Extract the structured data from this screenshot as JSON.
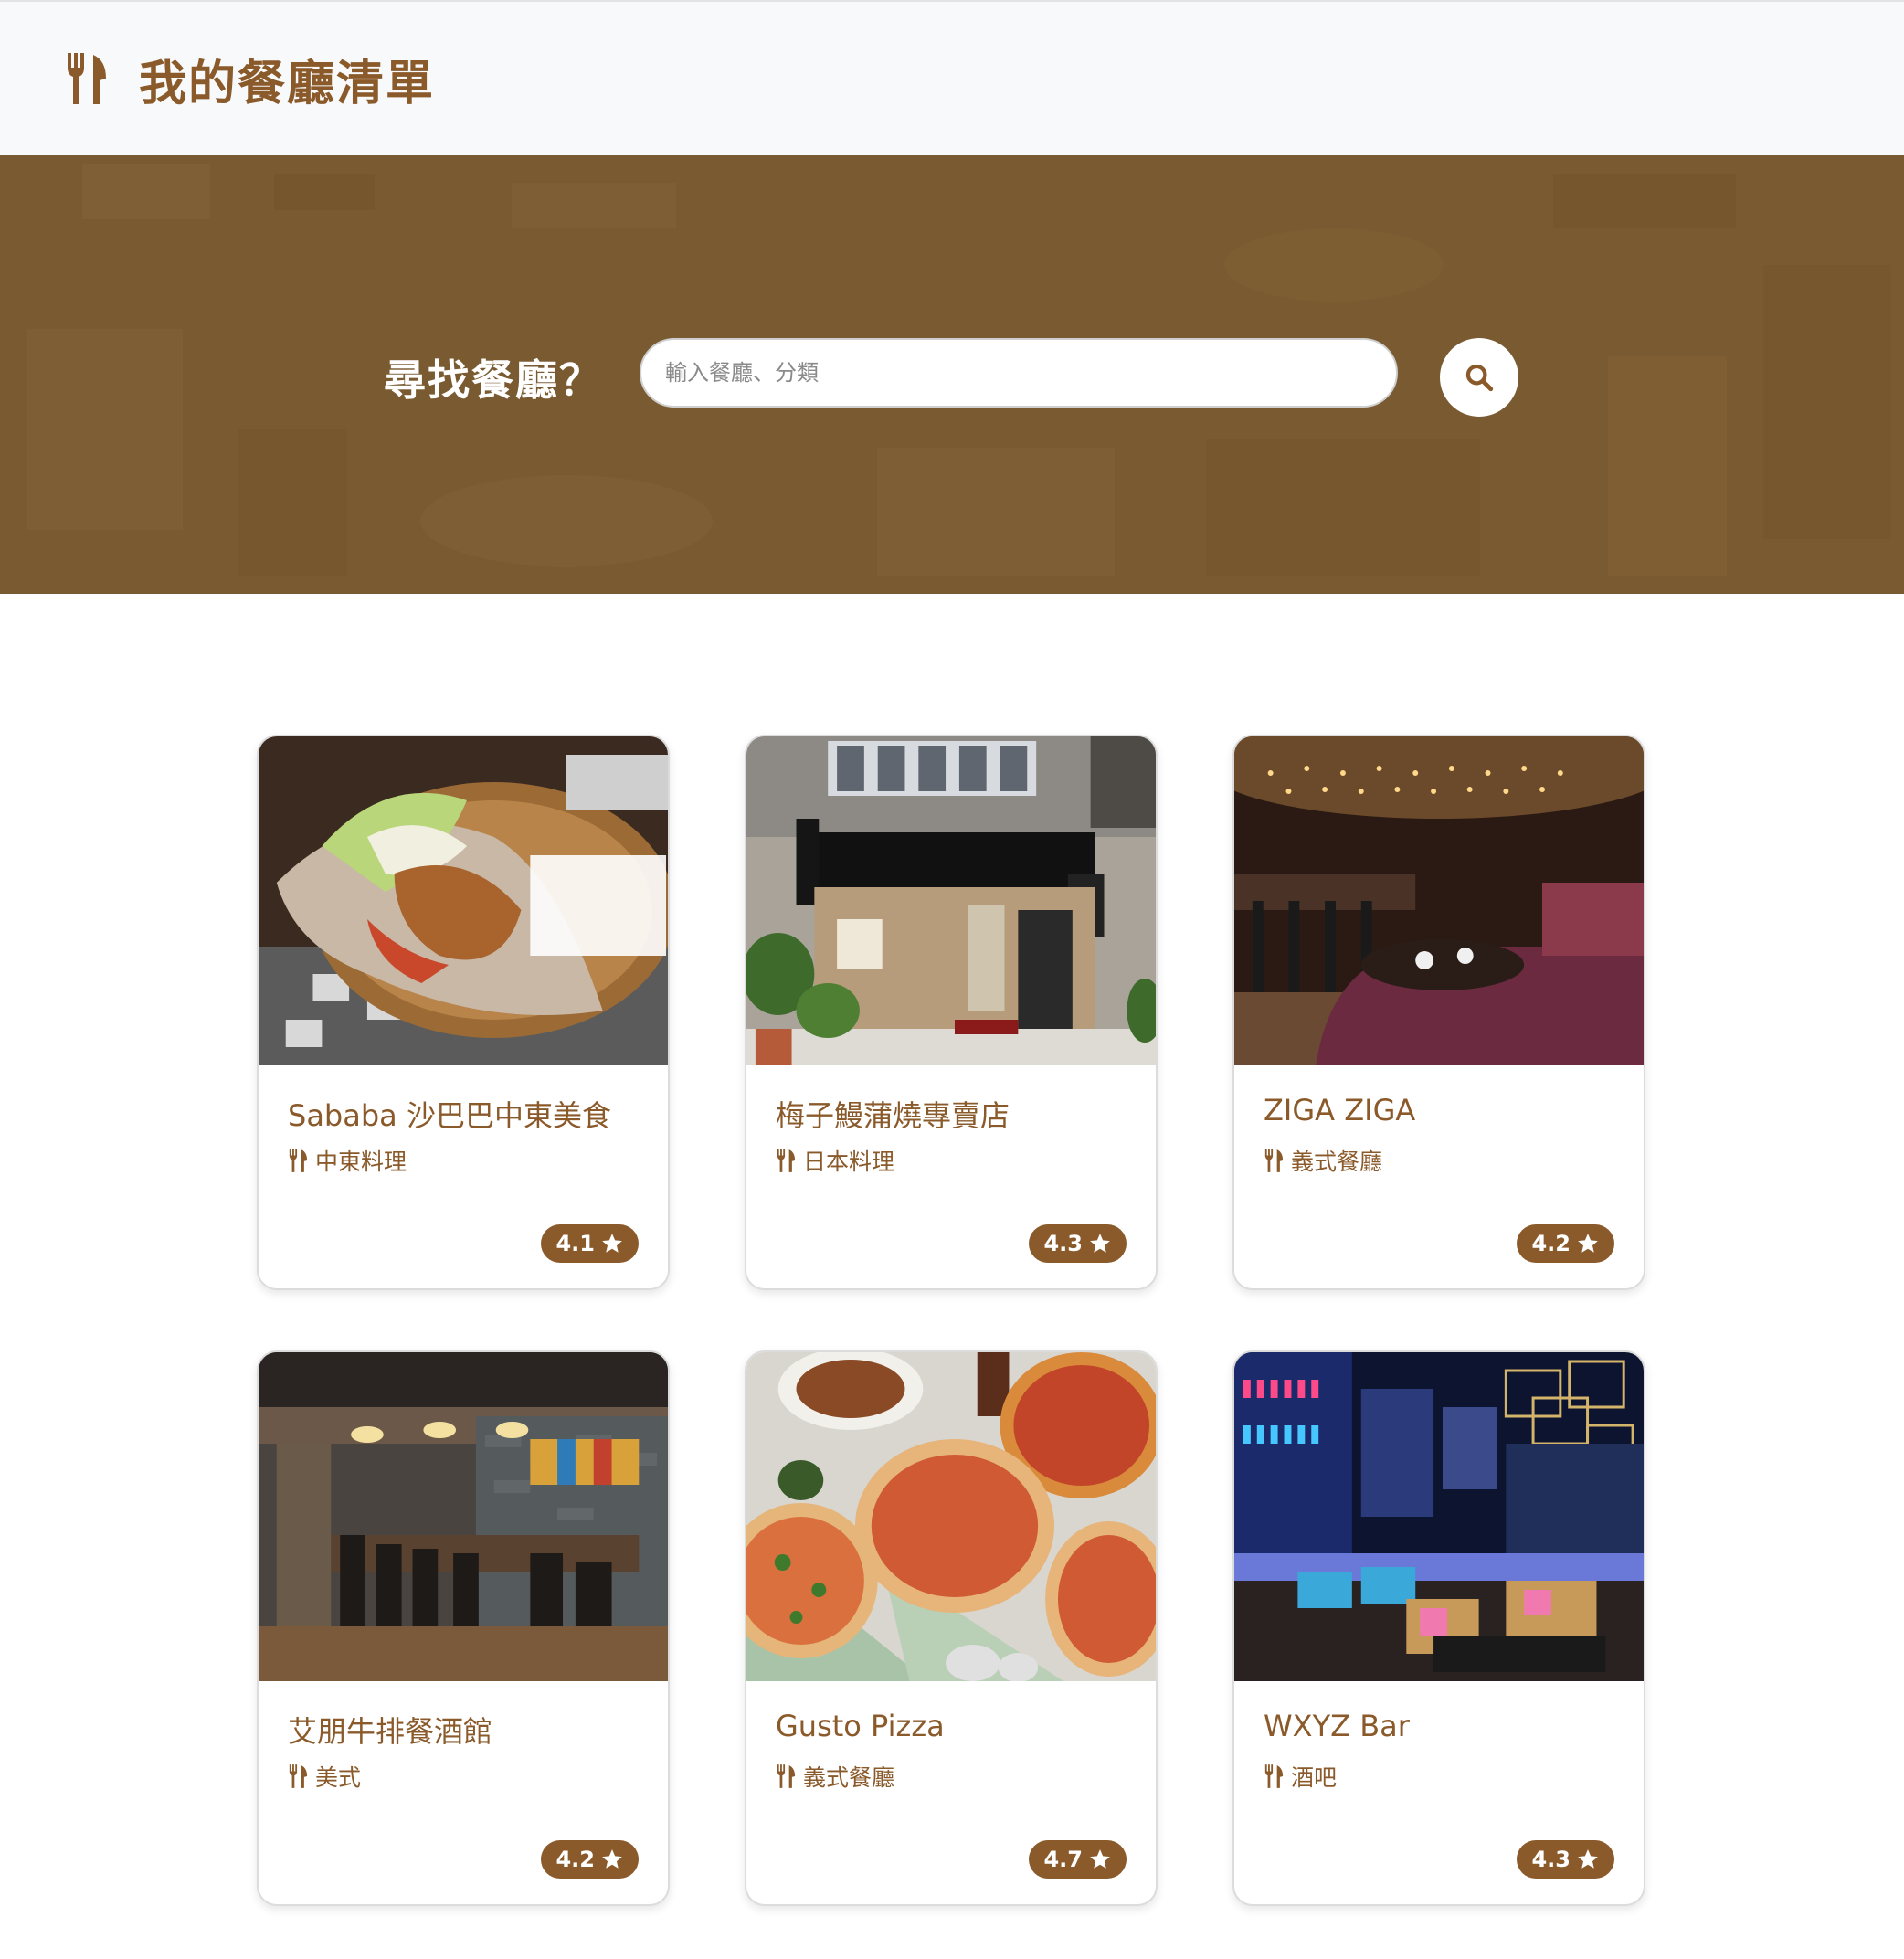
{
  "navbar": {
    "brand_title": "我的餐廳清單",
    "brand_icon": "utensils-icon"
  },
  "banner": {
    "search_label": "尋找餐廳？",
    "search_placeholder": "輸入餐廳、分類",
    "search_value": "",
    "search_button_icon": "search-icon"
  },
  "colors": {
    "brand": "#8b5a2b",
    "banner": "#7a5a30",
    "navbar_bg": "#f8f9fa"
  },
  "restaurants": [
    {
      "name": "Sababa 沙巴巴中東美食",
      "category": "中東料理",
      "rating": "4.1",
      "image": "pita-sandwich-photo"
    },
    {
      "name": "梅子鰻蒲燒專賣店",
      "category": "日本料理",
      "rating": "4.3",
      "image": "storefront-photo"
    },
    {
      "name": "ZIGA ZIGA",
      "category": "義式餐廳",
      "rating": "4.2",
      "image": "lounge-interior-photo"
    },
    {
      "name": "艾朋牛排餐酒館",
      "category": "美式",
      "rating": "4.2",
      "image": "dining-room-photo"
    },
    {
      "name": "Gusto Pizza",
      "category": "義式餐廳",
      "rating": "4.7",
      "image": "pizza-table-photo"
    },
    {
      "name": "WXYZ Bar",
      "category": "酒吧",
      "rating": "4.3",
      "image": "neon-bar-photo"
    }
  ]
}
